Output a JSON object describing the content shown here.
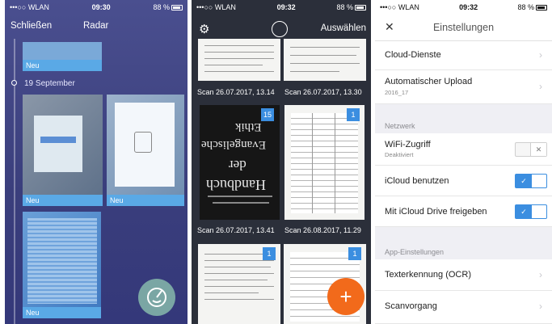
{
  "phone1": {
    "status": {
      "carrier": "•••○○ WLAN",
      "time": "09:30",
      "right": "88 %"
    },
    "nav": {
      "close": "Schließen",
      "radar": "Radar"
    },
    "date_header": "19 September",
    "items": [
      {
        "label": "Neu"
      },
      {
        "label": "Neu"
      },
      {
        "label": "Neu"
      },
      {
        "label": "Neu"
      }
    ]
  },
  "phone2": {
    "status": {
      "carrier": "•••○○ WLAN",
      "time": "09:32",
      "right": "88 %"
    },
    "nav": {
      "select": "Auswählen"
    },
    "captions": [
      "Scan 26.07.2017, 13.14",
      "Scan 26.07.2017, 13.30",
      "Scan 26.07.2017, 13.41",
      "Scan 26.08.2017, 11.29"
    ],
    "badges": [
      "15",
      "1",
      "1",
      "1"
    ],
    "book_title": [
      "Handbuch",
      "der",
      "Evangelische",
      "Ethik"
    ],
    "fab": "+"
  },
  "phone3": {
    "status": {
      "carrier": "•••○○ WLAN",
      "time": "09:32",
      "right": "88 %"
    },
    "nav": {
      "title": "Einstellungen"
    },
    "rows": {
      "cloud": "Cloud-Dienste",
      "upload": "Automatischer Upload",
      "upload_sub": "2016_17",
      "wifi": "WiFi-Zugriff",
      "wifi_sub": "Deaktiviert",
      "icloud": "iCloud benutzen",
      "icloud_drive": "Mit iCloud Drive freigeben",
      "ocr": "Texterkennung (OCR)",
      "scan": "Scanvorgang"
    },
    "sections": {
      "network": "Netzwerk",
      "app": "App-Einstellungen"
    },
    "colors": {
      "accent": "#3b8ee0"
    }
  }
}
